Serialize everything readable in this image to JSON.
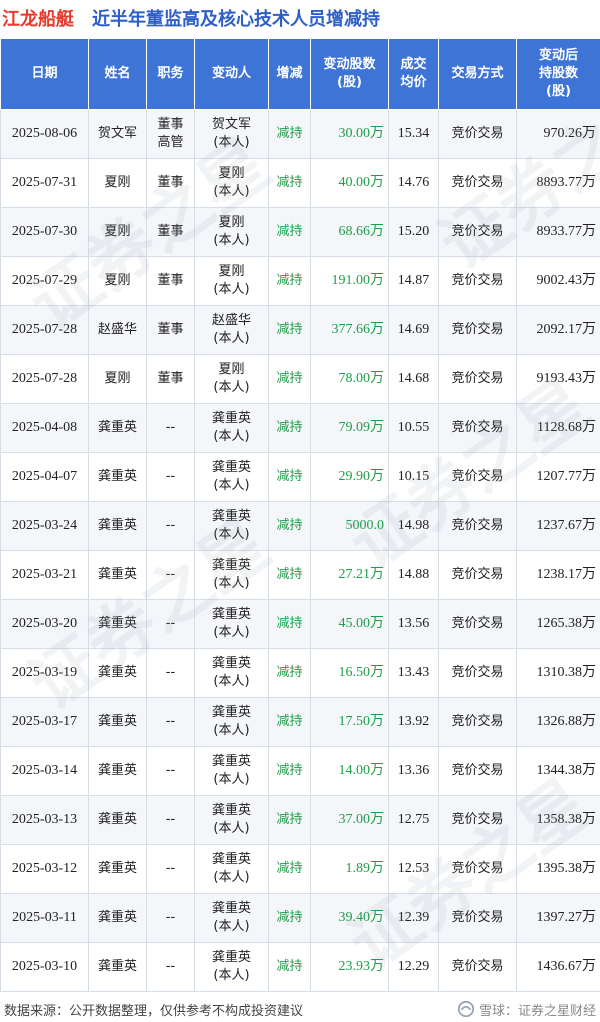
{
  "header": {
    "company": "江龙船艇",
    "title": "近半年董监高及核心技术人员增减持"
  },
  "table": {
    "columns": [
      {
        "label": "日期"
      },
      {
        "label": "姓名"
      },
      {
        "label": "职务"
      },
      {
        "label": "变动人"
      },
      {
        "label": "增减"
      },
      {
        "line1": "变动股数",
        "line2": "(股)"
      },
      {
        "line1": "成交",
        "line2": "均价"
      },
      {
        "label": "交易方式"
      },
      {
        "line1": "变动后",
        "line2": "持股数",
        "line3": "(股)"
      }
    ],
    "rows": [
      {
        "date": "2025-08-06",
        "name": "贺文军",
        "role1": "董事",
        "role2": "高管",
        "person1": "贺文军",
        "person2": "(本人)",
        "direction": "减持",
        "shares": "30.00万",
        "price": "15.34",
        "method": "竞价交易",
        "after": "970.26万"
      },
      {
        "date": "2025-07-31",
        "name": "夏刚",
        "role1": "董事",
        "role2": "",
        "person1": "夏刚",
        "person2": "(本人)",
        "direction": "减持",
        "shares": "40.00万",
        "price": "14.76",
        "method": "竞价交易",
        "after": "8893.77万"
      },
      {
        "date": "2025-07-30",
        "name": "夏刚",
        "role1": "董事",
        "role2": "",
        "person1": "夏刚",
        "person2": "(本人)",
        "direction": "减持",
        "shares": "68.66万",
        "price": "15.20",
        "method": "竞价交易",
        "after": "8933.77万"
      },
      {
        "date": "2025-07-29",
        "name": "夏刚",
        "role1": "董事",
        "role2": "",
        "person1": "夏刚",
        "person2": "(本人)",
        "direction": "减持",
        "shares": "191.00万",
        "price": "14.87",
        "method": "竞价交易",
        "after": "9002.43万"
      },
      {
        "date": "2025-07-28",
        "name": "赵盛华",
        "role1": "董事",
        "role2": "",
        "person1": "赵盛华",
        "person2": "(本人)",
        "direction": "减持",
        "shares": "377.66万",
        "price": "14.69",
        "method": "竞价交易",
        "after": "2092.17万"
      },
      {
        "date": "2025-07-28",
        "name": "夏刚",
        "role1": "董事",
        "role2": "",
        "person1": "夏刚",
        "person2": "(本人)",
        "direction": "减持",
        "shares": "78.00万",
        "price": "14.68",
        "method": "竞价交易",
        "after": "9193.43万"
      },
      {
        "date": "2025-04-08",
        "name": "龚重英",
        "role1": "--",
        "role2": "",
        "person1": "龚重英",
        "person2": "(本人)",
        "direction": "减持",
        "shares": "79.09万",
        "price": "10.55",
        "method": "竞价交易",
        "after": "1128.68万"
      },
      {
        "date": "2025-04-07",
        "name": "龚重英",
        "role1": "--",
        "role2": "",
        "person1": "龚重英",
        "person2": "(本人)",
        "direction": "减持",
        "shares": "29.90万",
        "price": "10.15",
        "method": "竞价交易",
        "after": "1207.77万"
      },
      {
        "date": "2025-03-24",
        "name": "龚重英",
        "role1": "--",
        "role2": "",
        "person1": "龚重英",
        "person2": "(本人)",
        "direction": "减持",
        "shares": "5000.0",
        "price": "14.98",
        "method": "竞价交易",
        "after": "1237.67万"
      },
      {
        "date": "2025-03-21",
        "name": "龚重英",
        "role1": "--",
        "role2": "",
        "person1": "龚重英",
        "person2": "(本人)",
        "direction": "减持",
        "shares": "27.21万",
        "price": "14.88",
        "method": "竞价交易",
        "after": "1238.17万"
      },
      {
        "date": "2025-03-20",
        "name": "龚重英",
        "role1": "--",
        "role2": "",
        "person1": "龚重英",
        "person2": "(本人)",
        "direction": "减持",
        "shares": "45.00万",
        "price": "13.56",
        "method": "竞价交易",
        "after": "1265.38万"
      },
      {
        "date": "2025-03-19",
        "name": "龚重英",
        "role1": "--",
        "role2": "",
        "person1": "龚重英",
        "person2": "(本人)",
        "direction": "减持",
        "shares": "16.50万",
        "price": "13.43",
        "method": "竞价交易",
        "after": "1310.38万"
      },
      {
        "date": "2025-03-17",
        "name": "龚重英",
        "role1": "--",
        "role2": "",
        "person1": "龚重英",
        "person2": "(本人)",
        "direction": "减持",
        "shares": "17.50万",
        "price": "13.92",
        "method": "竞价交易",
        "after": "1326.88万"
      },
      {
        "date": "2025-03-14",
        "name": "龚重英",
        "role1": "--",
        "role2": "",
        "person1": "龚重英",
        "person2": "(本人)",
        "direction": "减持",
        "shares": "14.00万",
        "price": "13.36",
        "method": "竞价交易",
        "after": "1344.38万"
      },
      {
        "date": "2025-03-13",
        "name": "龚重英",
        "role1": "--",
        "role2": "",
        "person1": "龚重英",
        "person2": "(本人)",
        "direction": "减持",
        "shares": "37.00万",
        "price": "12.75",
        "method": "竞价交易",
        "after": "1358.38万"
      },
      {
        "date": "2025-03-12",
        "name": "龚重英",
        "role1": "--",
        "role2": "",
        "person1": "龚重英",
        "person2": "(本人)",
        "direction": "减持",
        "shares": "1.89万",
        "price": "12.53",
        "method": "竞价交易",
        "after": "1395.38万"
      },
      {
        "date": "2025-03-11",
        "name": "龚重英",
        "role1": "--",
        "role2": "",
        "person1": "龚重英",
        "person2": "(本人)",
        "direction": "减持",
        "shares": "39.40万",
        "price": "12.39",
        "method": "竞价交易",
        "after": "1397.27万"
      },
      {
        "date": "2025-03-10",
        "name": "龚重英",
        "role1": "--",
        "role2": "",
        "person1": "龚重英",
        "person2": "(本人)",
        "direction": "减持",
        "shares": "23.93万",
        "price": "12.29",
        "method": "竞价交易",
        "after": "1436.67万"
      }
    ]
  },
  "watermark": "证券之星",
  "footer": {
    "source": "数据来源：公开数据整理，仅供参考不构成投资建议",
    "brand": "雪球：证券之星财经"
  },
  "colors": {
    "company": "#e8392d",
    "title": "#2f5fc6",
    "header_bg": "#3f74d7",
    "decrease": "#1e9e48"
  }
}
